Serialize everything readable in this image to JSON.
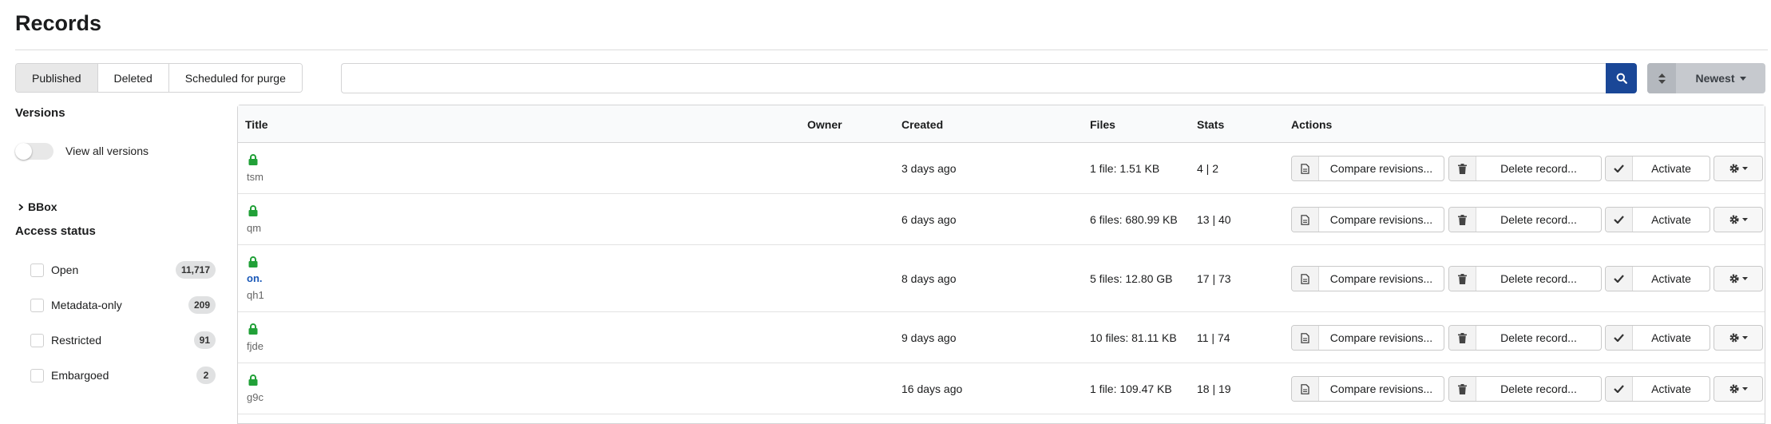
{
  "page": {
    "title": "Records"
  },
  "tabs": [
    {
      "label": "Published",
      "active": true
    },
    {
      "label": "Deleted",
      "active": false
    },
    {
      "label": "Scheduled for purge",
      "active": false
    }
  ],
  "search": {
    "value": "",
    "placeholder": ""
  },
  "sort": {
    "label": "Newest"
  },
  "sidebar": {
    "versions_heading": "Versions",
    "view_all_label": "View all versions",
    "bbox_label": "BBox",
    "access_heading": "Access status",
    "facets": [
      {
        "label": "Open",
        "count": "11,717"
      },
      {
        "label": "Metadata-only",
        "count": "209"
      },
      {
        "label": "Restricted",
        "count": "91"
      },
      {
        "label": "Embargoed",
        "count": "2"
      }
    ]
  },
  "table": {
    "headers": {
      "title": "Title",
      "owner": "Owner",
      "created": "Created",
      "files": "Files",
      "stats": "Stats",
      "actions": "Actions"
    },
    "actions": {
      "compare": "Compare revisions...",
      "delete": "Delete record...",
      "activate": "Activate"
    },
    "rows": [
      {
        "title": "",
        "id": "tsm",
        "owner": "",
        "created": "3 days ago",
        "files": "1 file: 1.51 KB",
        "stats": "4 | 2"
      },
      {
        "title": "",
        "id": "qm",
        "owner": "",
        "created": "6 days ago",
        "files": "6 files: 680.99 KB",
        "stats": "13 | 40"
      },
      {
        "title": "on.",
        "id": "qh1",
        "owner": "",
        "created": "8 days ago",
        "files": "5 files: 12.80 GB",
        "stats": "17 | 73"
      },
      {
        "title": "",
        "id": "fjde",
        "owner": "",
        "created": "9 days ago",
        "files": "10 files: 81.11 KB",
        "stats": "11 | 74"
      },
      {
        "title": "",
        "id": "g9c",
        "owner": "",
        "created": "16 days ago",
        "files": "1 file: 109.47 KB",
        "stats": "18 | 19"
      }
    ]
  },
  "colors": {
    "search_button": "#1a4797",
    "lock_icon": "#21a038",
    "link": "#1a58b8"
  }
}
